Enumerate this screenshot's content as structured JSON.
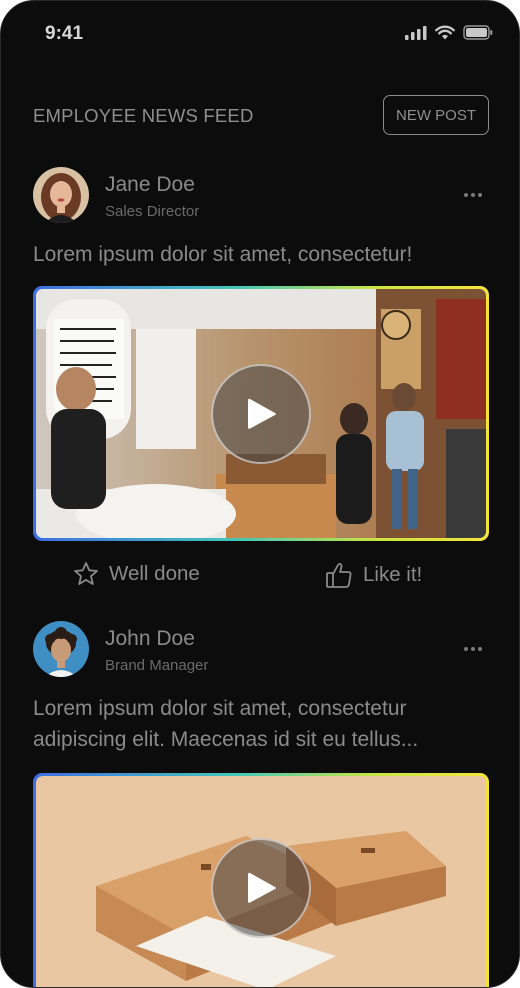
{
  "status_bar": {
    "time": "9:41",
    "icons": [
      "signal-icon",
      "wifi-icon",
      "battery-icon"
    ]
  },
  "feed": {
    "title": "EMPLOYEE NEWS FEED",
    "new_post_label": "NEW POST"
  },
  "posts": [
    {
      "author": {
        "name": "Jane Doe",
        "role": "Sales Director"
      },
      "text": "Lorem ipsum dolor sit amet, consectetur!",
      "media": {
        "type": "video",
        "subject": "coffee shop"
      },
      "reactions": {
        "well_done_label": "Well done",
        "like_label": "Like it!"
      }
    },
    {
      "author": {
        "name": "John Doe",
        "role": "Brand Manager"
      },
      "text": "Lorem ipsum dolor sit amet, consectetur adipiscing elit. Maecenas id sit eu tellus...",
      "media": {
        "type": "video",
        "subject": "cardboard boxes"
      }
    }
  ],
  "colors": {
    "background": "#0c0c0d",
    "text_primary": "#8a8a8a",
    "gradient": [
      "#3f6de3",
      "#43c7b8",
      "#c8e542",
      "#f4e33c"
    ]
  }
}
